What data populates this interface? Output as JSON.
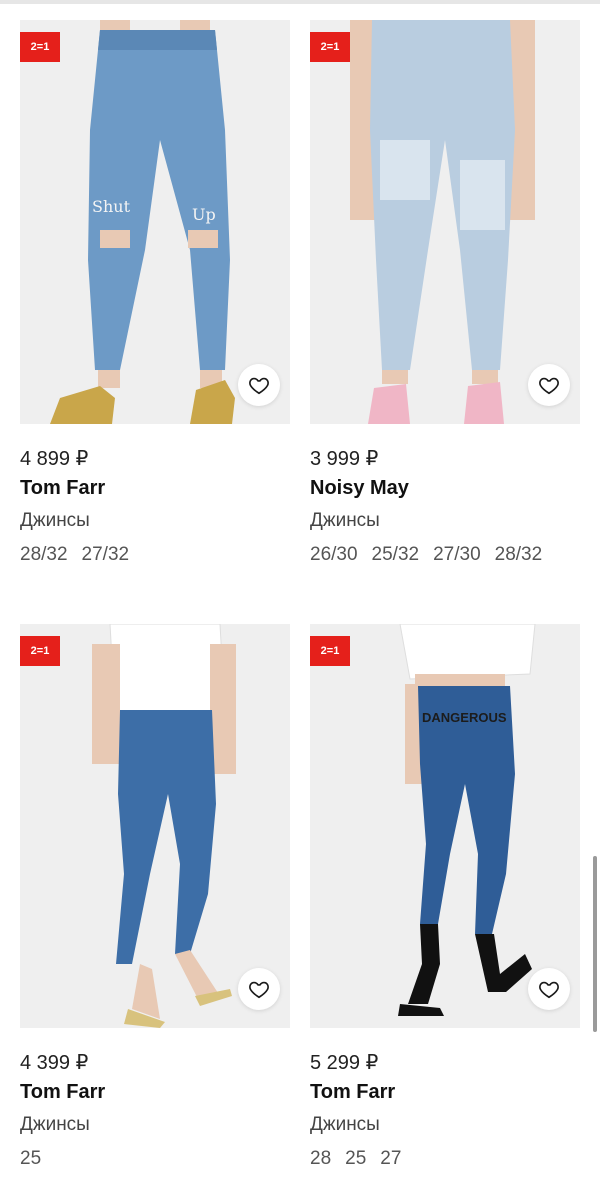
{
  "colors": {
    "promo": "#e5201b",
    "background": "#ffffff",
    "text": "#1a1a1a"
  },
  "products": [
    {
      "promo": "2=1",
      "price": "4 899 ₽",
      "brand": "Tom Farr",
      "category": "Джинсы",
      "sizes": [
        "28/32",
        "27/32"
      ],
      "favorite_icon": "heart-outline-icon"
    },
    {
      "promo": "2=1",
      "price": "3 999 ₽",
      "brand": "Noisy May",
      "category": "Джинсы",
      "sizes": [
        "26/30",
        "25/32",
        "27/30",
        "28/32"
      ],
      "favorite_icon": "heart-outline-icon"
    },
    {
      "promo": "2=1",
      "price": "4 399 ₽",
      "brand": "Tom Farr",
      "category": "Джинсы",
      "sizes": [
        "25"
      ],
      "favorite_icon": "heart-outline-icon"
    },
    {
      "promo": "2=1",
      "price": "5 299 ₽",
      "brand": "Tom Farr",
      "category": "Джинсы",
      "sizes": [
        "28",
        "25",
        "27"
      ],
      "favorite_icon": "heart-outline-icon"
    }
  ]
}
